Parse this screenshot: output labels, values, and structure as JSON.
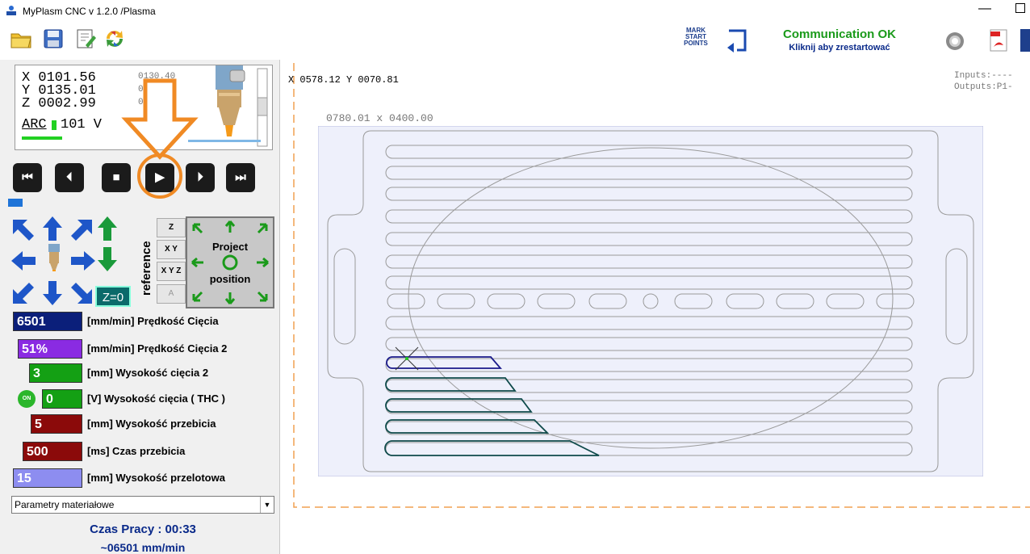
{
  "window": {
    "title": "MyPlasm CNC v 1.2.0  /Plasma",
    "minimize": "—"
  },
  "toolbar": {
    "icons": [
      "open-folder-icon",
      "save-icon",
      "edit-document-icon",
      "refresh-icon"
    ],
    "mark_start_points_lines": [
      "MARK",
      "START",
      "POINTS"
    ],
    "communication_status": "Communication OK",
    "communication_hint": "Kliknij aby zrestartować",
    "accent_green": "#1a9a1a",
    "accent_blue": "#0a2a8a"
  },
  "coords": {
    "x": "X 0101.56",
    "y": "Y 0135.01",
    "z": "Z 0002.99",
    "x_small": "0130.40",
    "y_small": "0",
    "z_small": "0",
    "arc_label": "ARC",
    "arc_value": "101 V"
  },
  "playback": {
    "buttons": [
      {
        "name": "skip-to-start-button",
        "glyph": "⏮"
      },
      {
        "name": "step-back-button",
        "glyph": "⏴"
      },
      {
        "name": "stop-button",
        "glyph": "■"
      },
      {
        "name": "play-button",
        "glyph": "▶"
      },
      {
        "name": "step-forward-button",
        "glyph": "⏵"
      },
      {
        "name": "skip-to-end-button",
        "glyph": "⏭"
      }
    ],
    "progress_fraction": 0.06
  },
  "jog": {
    "reference_label": "reference",
    "ref_buttons": [
      "Z",
      "X Y",
      "X Y Z",
      "A"
    ],
    "project_line1": "Project",
    "project_line2": "position",
    "z_zero": "Z=0"
  },
  "params": [
    {
      "value": "6501",
      "label": "[mm/min] Prędkość Cięcia",
      "color": "#0b1f7a"
    },
    {
      "value": "51%",
      "label": "[mm/min] Prędkość Cięcia 2",
      "color": "#8a2be2"
    },
    {
      "value": "3",
      "label": "[mm] Wysokość cięcia 2",
      "color": "#14a014"
    },
    {
      "value": "0",
      "label": "[V] Wysokość cięcia ( THC )",
      "color": "#14a014"
    },
    {
      "value": "5",
      "label": "[mm] Wysokość przebicia",
      "color": "#8b0a0a"
    },
    {
      "value": "500",
      "label": "[ms] Czas przebicia",
      "color": "#8b0a0a"
    },
    {
      "value": "15",
      "label": "[mm] Wysokość przelotowa",
      "color": "#8d8df0"
    }
  ],
  "thc_toggle": "ON",
  "material_select": "Parametry materiałowe",
  "work_time": "Czas Pracy : 00:33",
  "current_speed": "~06501 mm/min",
  "canvas": {
    "cursor_xy": "X 0578.12  Y 0070.81",
    "inputs": "Inputs:----",
    "outputs": "Outputs:P1-",
    "sheet_size": "0780.01 x  0400.00"
  }
}
